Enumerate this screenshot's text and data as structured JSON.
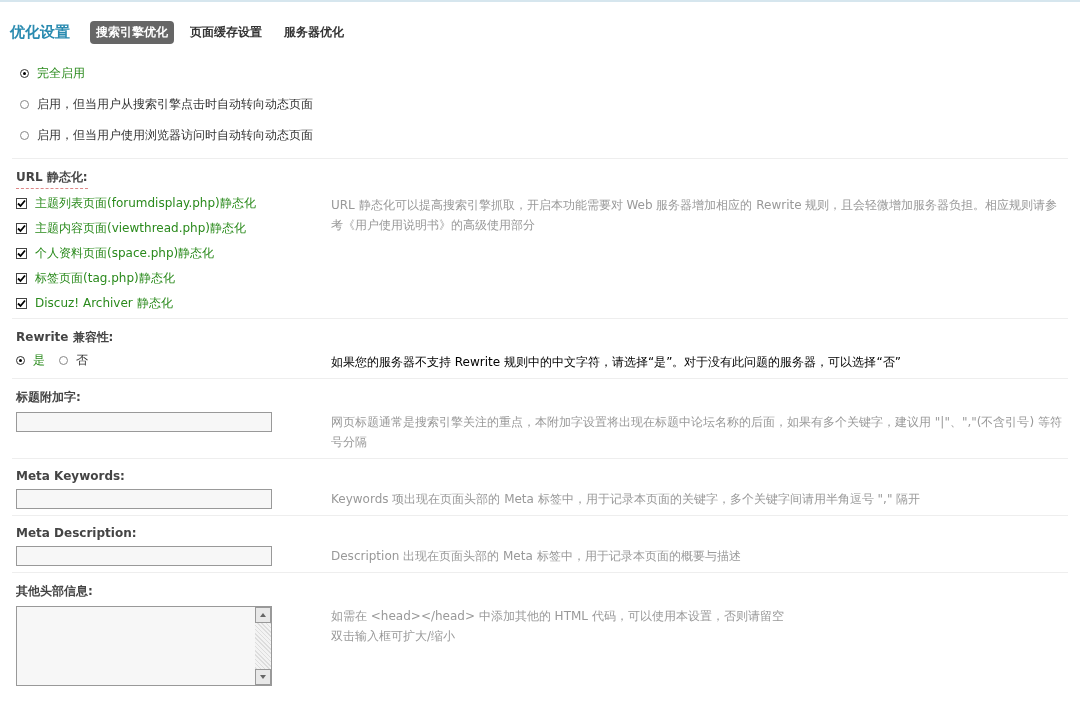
{
  "header": {
    "title": "优化设置",
    "tabs": [
      {
        "label": "搜索引擎优化",
        "selected": true
      },
      {
        "label": "页面缓存设置",
        "selected": false
      },
      {
        "label": "服务器优化",
        "selected": false
      }
    ]
  },
  "mode_options": [
    {
      "label": "完全启用",
      "selected": true
    },
    {
      "label": "启用，但当用户从搜索引擎点击时自动转向动态页面",
      "selected": false
    },
    {
      "label": "启用，但当用户使用浏览器访问时自动转向动态页面",
      "selected": false
    }
  ],
  "sections": [
    {
      "kind": "checklist",
      "title": "URL 静态化:",
      "items": [
        {
          "label": "主题列表页面(forumdisplay.php)静态化",
          "checked": true
        },
        {
          "label": "主题内容页面(viewthread.php)静态化",
          "checked": true
        },
        {
          "label": "个人资料页面(space.php)静态化",
          "checked": true
        },
        {
          "label": "标签页面(tag.php)静态化",
          "checked": true
        },
        {
          "label": "Discuz! Archiver 静态化",
          "checked": true
        }
      ],
      "description": "URL 静态化可以提高搜索引擎抓取，开启本功能需要对 Web 服务器增加相应的 Rewrite 规则，且会轻微增加服务器负担。相应规则请参考《用户使用说明书》的高级使用部分"
    },
    {
      "kind": "radio",
      "title": "Rewrite 兼容性:",
      "options": [
        {
          "label": "是",
          "selected": true
        },
        {
          "label": "否",
          "selected": false
        }
      ],
      "description": "如果您的服务器不支持 Rewrite 规则中的中文字符，请选择“是”。对于没有此问题的服务器，可以选择“否”"
    },
    {
      "kind": "text",
      "title": "标题附加字:",
      "description": "网页标题通常是搜索引擎关注的重点，本附加字设置将出现在标题中论坛名称的后面，如果有多个关键字，建议用 \"|\"、\",\"(不含引号) 等符号分隔"
    },
    {
      "kind": "text",
      "title": "Meta Keywords:",
      "description": "Keywords 项出现在页面头部的 Meta 标签中，用于记录本页面的关键字，多个关键字间请用半角逗号 \",\" 隔开"
    },
    {
      "kind": "text",
      "title": "Meta Description:",
      "description": "Description 出现在页面头部的 Meta 标签中，用于记录本页面的概要与描述"
    },
    {
      "kind": "textarea",
      "title": "其他头部信息:",
      "description": "如需在 <head></head> 中添加其他的 HTML 代码，可以使用本设置，否则请留空",
      "note": "双击输入框可扩大/缩小"
    }
  ]
}
